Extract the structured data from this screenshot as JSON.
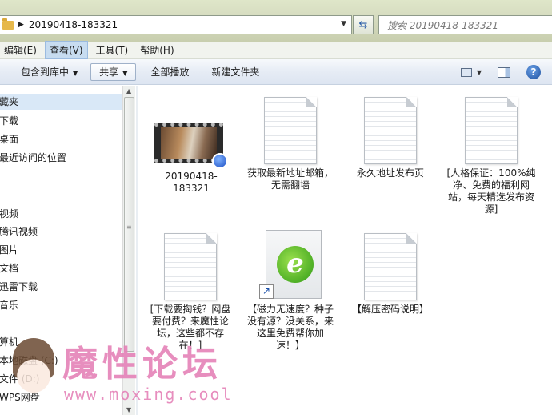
{
  "address_bar": {
    "path": "20190418-183321",
    "search_placeholder": "搜索 20190418-183321"
  },
  "menu": [
    {
      "label": "编辑(E)",
      "active": false
    },
    {
      "label": "查看(V)",
      "active": true
    },
    {
      "label": "工具(T)",
      "active": false
    },
    {
      "label": "帮助(H)",
      "active": false
    }
  ],
  "toolbar": {
    "include_library": "包含到库中",
    "share": "共享",
    "play_all": "全部播放",
    "new_folder": "新建文件夹"
  },
  "nav": {
    "items": [
      "藏夹",
      "下载",
      "桌面",
      "最近访问的位置",
      "视频",
      "腾讯视频",
      "图片",
      "文档",
      "迅雷下载",
      "音乐",
      "算机",
      "本地磁盘 (C:)",
      "文件 (D:)",
      "WPS网盘"
    ]
  },
  "files": [
    {
      "type": "video",
      "name": "20190418-183321"
    },
    {
      "type": "text",
      "name": "获取最新地址邮箱，无需翻墙"
    },
    {
      "type": "text",
      "name": "永久地址发布页"
    },
    {
      "type": "text",
      "name": "[人格保证：100%纯净、免费的福利网站，每天精选发布资源]"
    },
    {
      "type": "text",
      "name": "[下载要掏钱？网盘要付费？来魔性论坛，这些都不存在！]"
    },
    {
      "type": "shortcut",
      "name": "【磁力无速度？种子没有源？没关系，来这里免费帮你加速！】"
    },
    {
      "type": "text",
      "name": "【解压密码说明】"
    }
  ],
  "watermark": {
    "title": "魔性论坛",
    "url": "www.moxing.cool"
  },
  "icons": {
    "help": "?",
    "refresh": "⇆"
  }
}
